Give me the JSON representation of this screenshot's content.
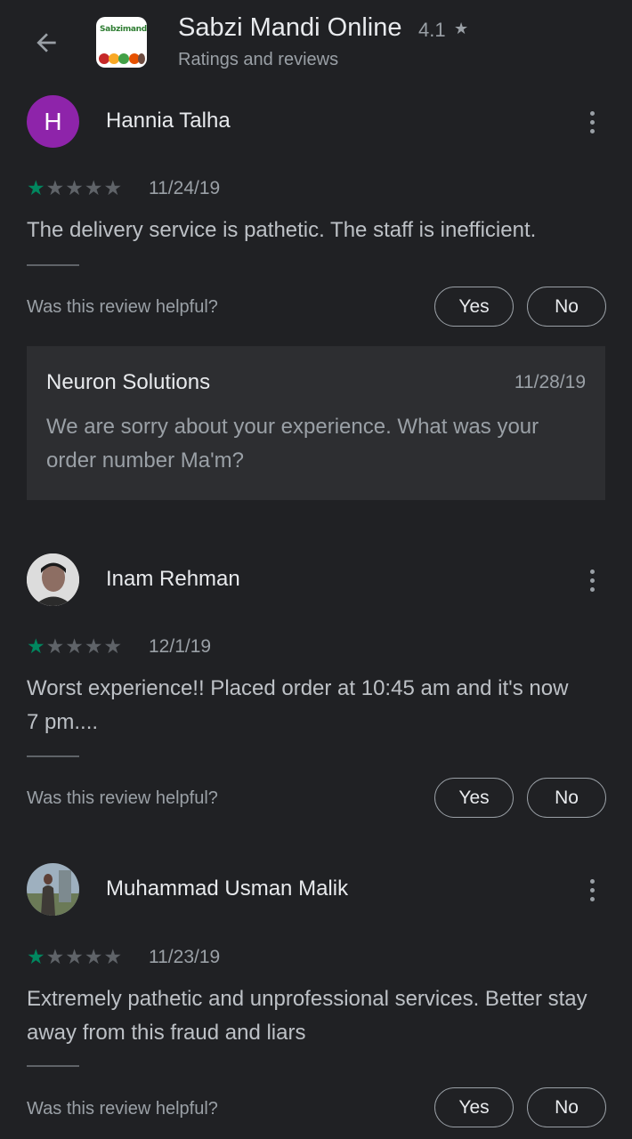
{
  "header": {
    "back_icon": "arrow-back-icon",
    "app_icon_text": "Sabzimandi",
    "title": "Sabzi Mandi Online",
    "rating": "4.1",
    "rating_star": "★",
    "subtitle": "Ratings and reviews"
  },
  "helpful_prompt": "Was this review helpful?",
  "yes_label": "Yes",
  "no_label": "No",
  "reviews": [
    {
      "avatar_letter": "H",
      "avatar_color": "#8e24aa",
      "name": "Hannia Talha",
      "stars": 1,
      "date": "11/24/19",
      "text": "The delivery service is pathetic. The staff is inefficient.",
      "reply": {
        "name": "Neuron Solutions",
        "date": "11/28/19",
        "text": "We are sorry about your experience. What was your order number Ma'm?"
      }
    },
    {
      "avatar_letter": "",
      "name": "Inam Rehman",
      "stars": 1,
      "date": "12/1/19",
      "text": "Worst experience!! Placed order at 10:45 am and it's now 7 pm...."
    },
    {
      "avatar_letter": "",
      "name": "Muhammad Usman Malik",
      "stars": 1,
      "date": "11/23/19",
      "text": "Extremely pathetic and unprofessional services. Better stay away from this fraud and liars"
    }
  ],
  "colors": {
    "background": "#202124",
    "star_filled": "#01875f",
    "star_empty": "#5f6368"
  }
}
